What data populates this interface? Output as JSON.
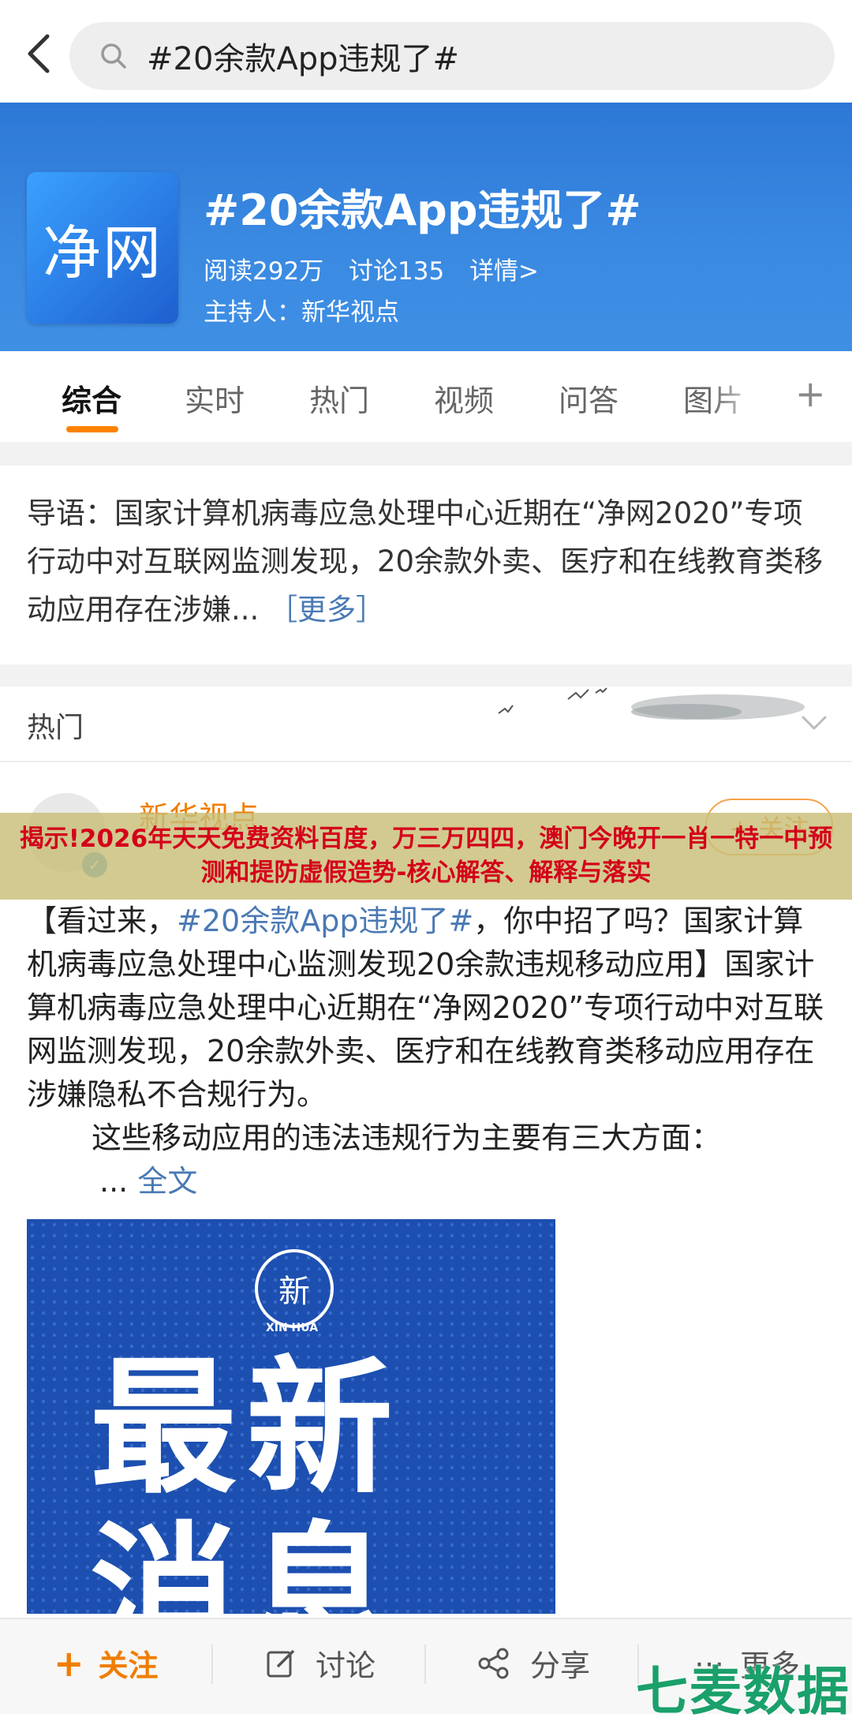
{
  "search": {
    "query": "#20余款App违规了#"
  },
  "topic": {
    "logo_text": "净网",
    "title": "#20余款App违规了#",
    "reads": "阅读292万",
    "discussions": "讨论135",
    "details": "详情>",
    "host": "主持人：新华视点"
  },
  "tabs": [
    {
      "label": "综合"
    },
    {
      "label": "实时"
    },
    {
      "label": "热门"
    },
    {
      "label": "视频"
    },
    {
      "label": "问答"
    },
    {
      "label": "图片"
    }
  ],
  "tabs_plus": "+",
  "intro": {
    "text": "导语：国家计算机病毒应急处理中心近期在“净网2020”专项行动中对互联网监测发现，20余款外卖、医疗和在线教育类移动应用存在涉嫌...",
    "more": "［更多］"
  },
  "hot_section": {
    "label": "热门"
  },
  "post": {
    "author": "新华视点",
    "follow": "+ 关注",
    "body_open": "【看过来，",
    "body_tag": "#20余款App违规了#",
    "body_rest": "，你中招了吗？国家计算机病毒应急处理中心监测发现20余款违规移动应用】国家计算机病毒应急处理中心近期在“净网2020”专项行动中对互联网监测发现，20余款外卖、医疗和在线教育类移动应用存在涉嫌隐私不合规行为。",
    "body_indent": "这些移动应用的违法违规行为主要有三大方面：",
    "ellipsis": "...",
    "full_text": "全文",
    "image": {
      "emblem_sub": "XIN HUA",
      "title": "最新消息"
    }
  },
  "overlay": {
    "text": "揭示!2026年天天免费资料百度，万三万四四，澳门今晚开一肖一特一中预测和提防虚假造势-核心解答、解释与落实"
  },
  "bottom_bar": {
    "follow": "关注",
    "discuss": "讨论",
    "share": "分享",
    "more": "更多"
  },
  "watermark": "七麦数据",
  "colors": {
    "accent": "#ff8200",
    "banner": "#3a8ae2",
    "link": "#4a79b4"
  }
}
